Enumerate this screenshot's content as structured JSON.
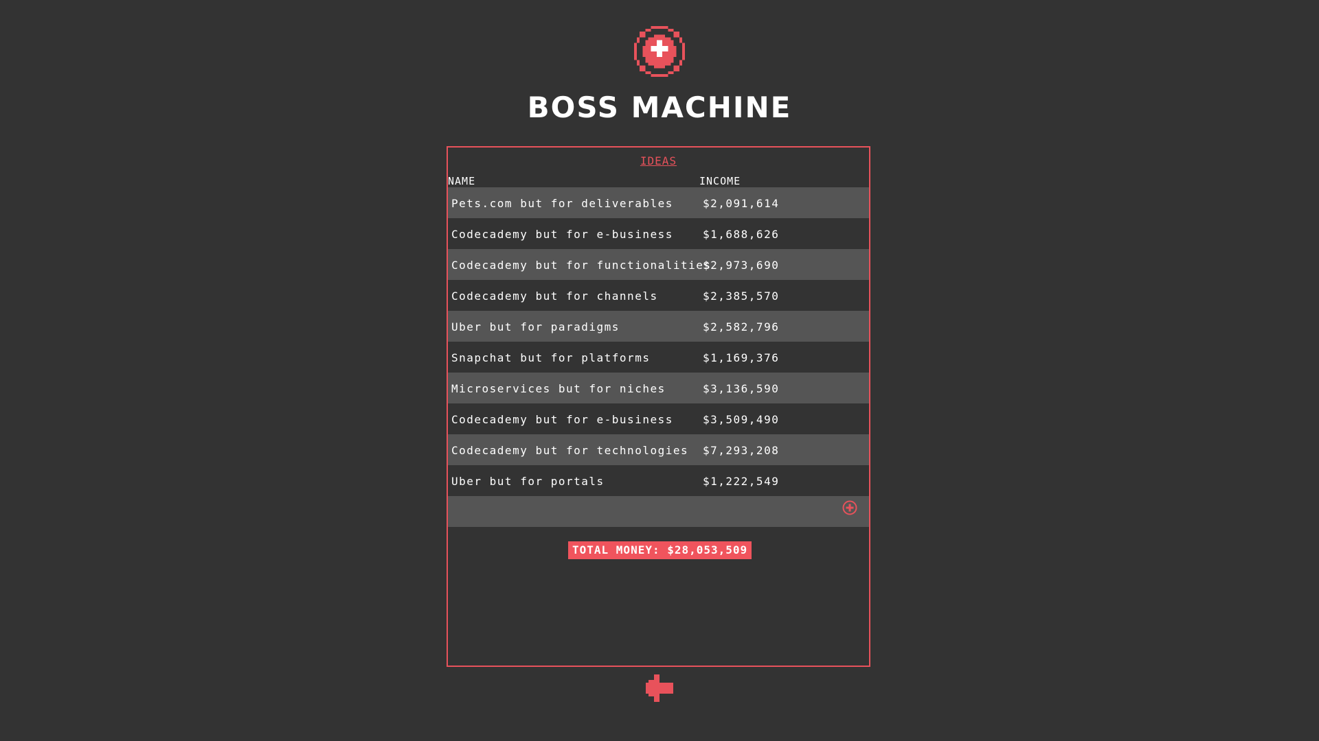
{
  "app": {
    "title": "BOSS MACHINE",
    "logo_icon": "boss-machine-logo-icon"
  },
  "panel": {
    "tab_label": "IDEAS",
    "columns": {
      "name": "NAME",
      "income": "INCOME"
    },
    "rows": [
      {
        "name": "Pets.com but for deliverables",
        "income": "$2,091,614"
      },
      {
        "name": "Codecademy but for e-business",
        "income": "$1,688,626"
      },
      {
        "name": "Codecademy but for functionalities",
        "income": "$2,973,690"
      },
      {
        "name": "Codecademy but for channels",
        "income": "$2,385,570"
      },
      {
        "name": "Uber but for paradigms",
        "income": "$2,582,796"
      },
      {
        "name": "Snapchat but for platforms",
        "income": "$1,169,376"
      },
      {
        "name": "Microservices but for niches",
        "income": "$3,136,590"
      },
      {
        "name": "Codecademy but for e-business",
        "income": "$3,509,490"
      },
      {
        "name": "Codecademy but for technologies",
        "income": "$7,293,208"
      },
      {
        "name": "Uber but for portals",
        "income": "$1,222,549"
      }
    ],
    "add_icon": "plus-circle-icon",
    "total_label": "TOTAL MONEY: $28,053,509"
  },
  "nav": {
    "back_icon": "arrow-left-icon"
  },
  "colors": {
    "background": "#333333",
    "accent": "#e8525b",
    "row_alt": "#555555",
    "text": "#ffffff"
  }
}
